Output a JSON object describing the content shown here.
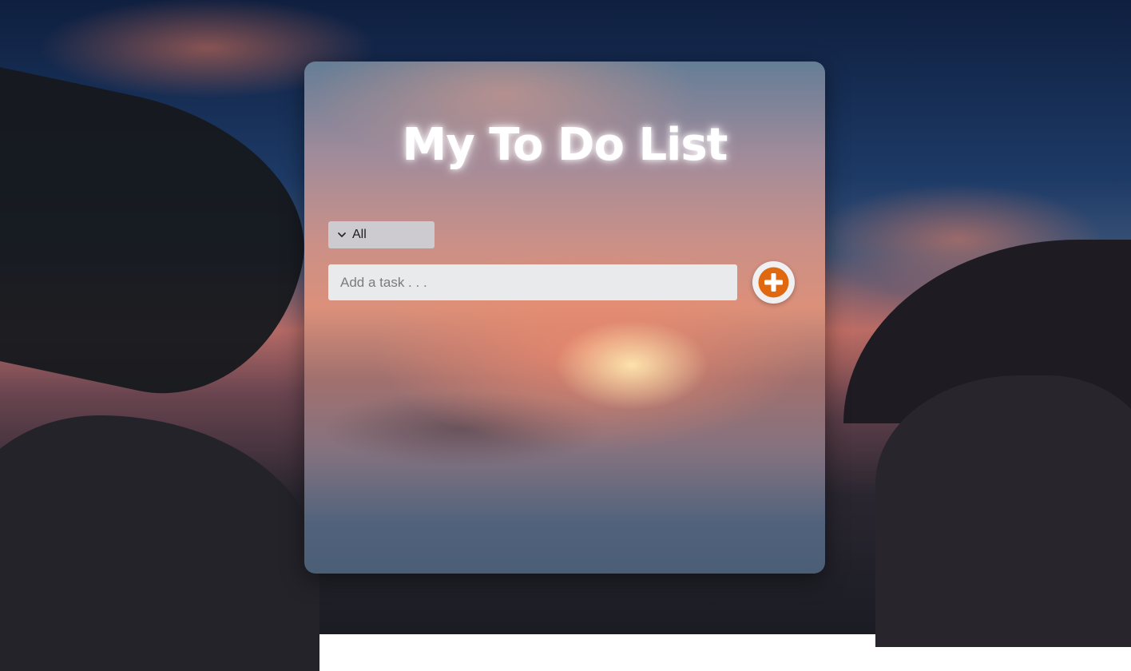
{
  "app": {
    "title": "My To Do List"
  },
  "filter": {
    "selected": "All"
  },
  "task_input": {
    "value": "",
    "placeholder": "Add a task . . ."
  },
  "icons": {
    "filter_dropdown": "chevron-down-icon",
    "add_task": "plus-circle-icon"
  },
  "colors": {
    "accent": "#e0690f",
    "input_bg": "#e9eaec",
    "title_text": "#ffffff"
  }
}
